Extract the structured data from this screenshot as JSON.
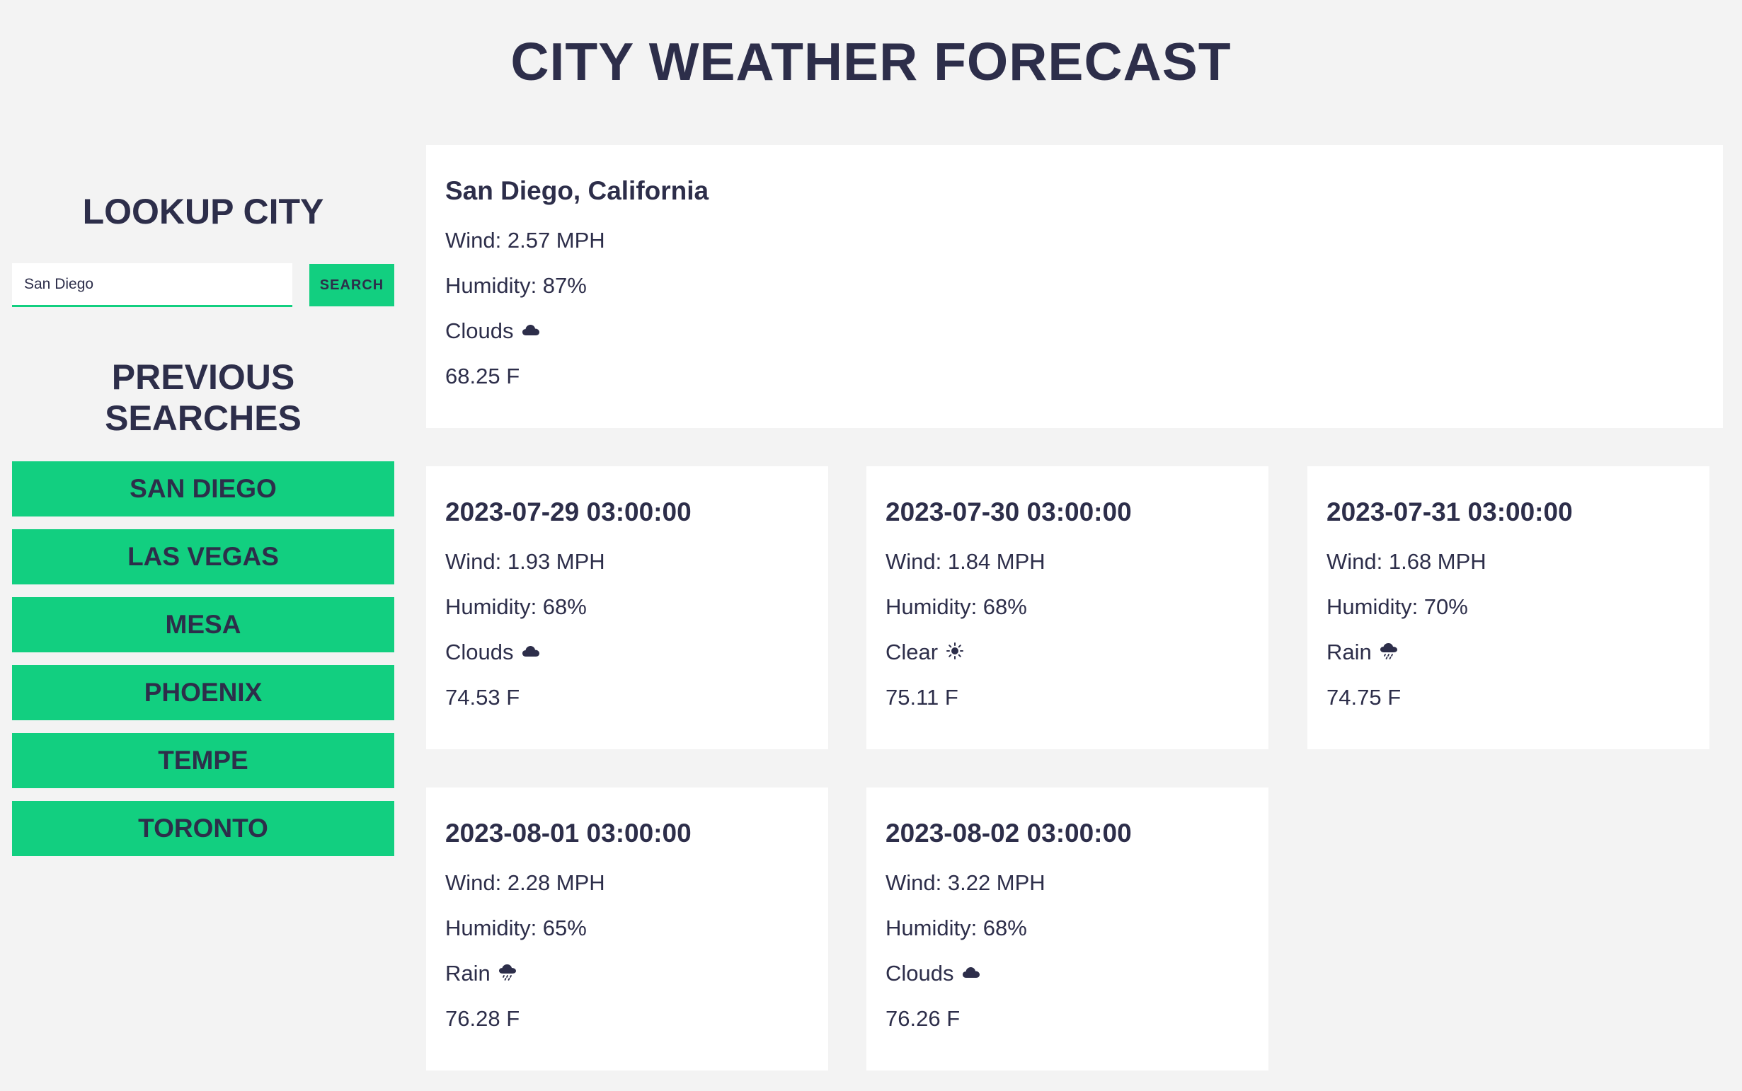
{
  "page": {
    "title": "CITY WEATHER FORECAST"
  },
  "sidebar": {
    "lookup_heading": "LOOKUP CITY",
    "search": {
      "value": "San Diego",
      "button_label": "SEARCH"
    },
    "previous_heading": "PREVIOUS SEARCHES",
    "history": [
      "SAN DIEGO",
      "LAS VEGAS",
      "MESA",
      "PHOENIX",
      "TEMPE",
      "TORONTO"
    ]
  },
  "current": {
    "city": "San Diego, California",
    "wind": "Wind: 2.57 MPH",
    "humidity": "Humidity: 87%",
    "condition": "Clouds",
    "condition_icon": "cloud-icon",
    "temp": "68.25 F"
  },
  "forecast": [
    {
      "date": "2023-07-29 03:00:00",
      "wind": "Wind: 1.93 MPH",
      "humidity": "Humidity: 68%",
      "condition": "Clouds",
      "condition_icon": "cloud-icon",
      "temp": "74.53 F"
    },
    {
      "date": "2023-07-30 03:00:00",
      "wind": "Wind: 1.84 MPH",
      "humidity": "Humidity: 68%",
      "condition": "Clear",
      "condition_icon": "sun-icon",
      "temp": "75.11 F"
    },
    {
      "date": "2023-07-31 03:00:00",
      "wind": "Wind: 1.68 MPH",
      "humidity": "Humidity: 70%",
      "condition": "Rain",
      "condition_icon": "rain-icon",
      "temp": "74.75 F"
    },
    {
      "date": "2023-08-01 03:00:00",
      "wind": "Wind: 2.28 MPH",
      "humidity": "Humidity: 65%",
      "condition": "Rain",
      "condition_icon": "rain-icon",
      "temp": "76.28 F"
    },
    {
      "date": "2023-08-02 03:00:00",
      "wind": "Wind: 3.22 MPH",
      "humidity": "Humidity: 68%",
      "condition": "Clouds",
      "condition_icon": "cloud-icon",
      "temp": "76.26 F"
    }
  ],
  "colors": {
    "background": "#f3f3f3",
    "text": "#2d2e4a",
    "accent": "#12cf80",
    "card": "#ffffff"
  }
}
